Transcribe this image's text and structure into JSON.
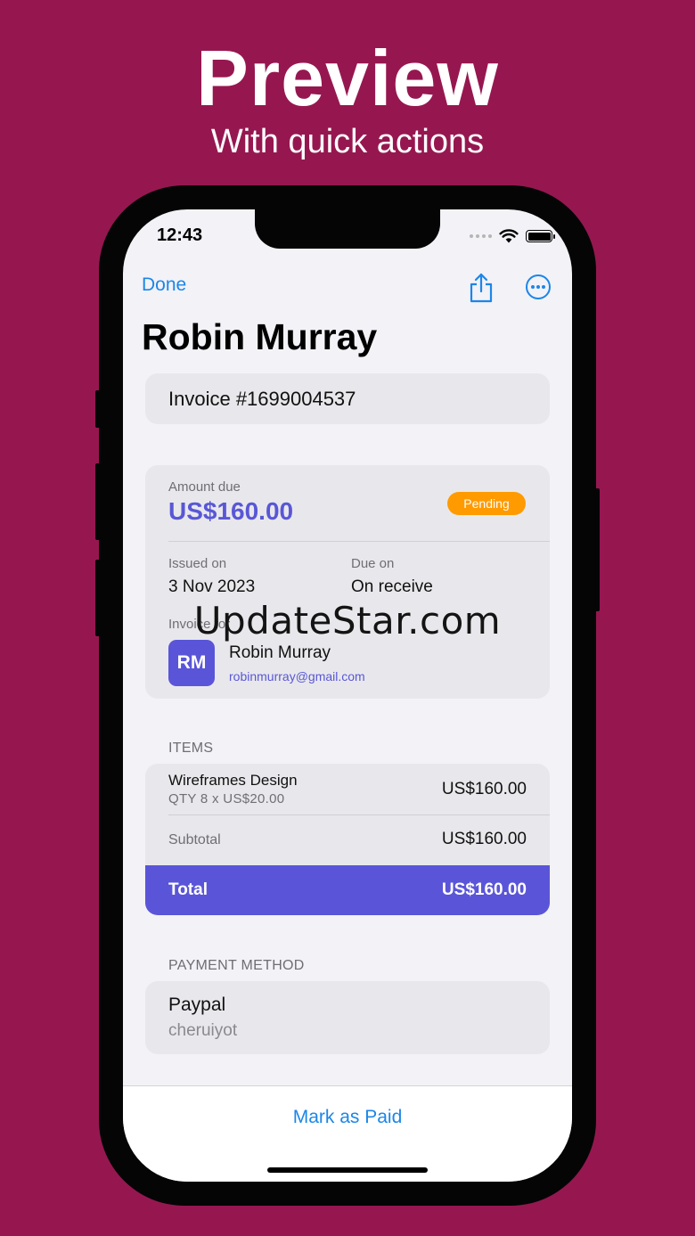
{
  "promo": {
    "title": "Preview",
    "subtitle": "With quick actions"
  },
  "status_bar": {
    "time": "12:43"
  },
  "nav": {
    "done_label": "Done"
  },
  "page_title": "Robin Murray",
  "invoice": {
    "number": "Invoice #1699004537"
  },
  "amount": {
    "label": "Amount due",
    "value": "US$160.00",
    "status": "Pending"
  },
  "dates": {
    "issued_label": "Issued on",
    "issued_value": "3 Nov 2023",
    "due_label": "Due on",
    "due_value": "On receive"
  },
  "client": {
    "section_label": "Invoice for",
    "initials": "RM",
    "name": "Robin Murray",
    "email": "robinmurray@gmail.com"
  },
  "items": {
    "header": "ITEMS",
    "rows": [
      {
        "name": "Wireframes Design",
        "qty": "QTY 8 x US$20.00",
        "price": "US$160.00"
      }
    ],
    "subtotal_label": "Subtotal",
    "subtotal_value": "US$160.00",
    "total_label": "Total",
    "total_value": "US$160.00"
  },
  "payment": {
    "header": "PAYMENT METHOD",
    "method": "Paypal",
    "account": "cheruiyot"
  },
  "actions": {
    "mark_paid": "Mark as Paid"
  },
  "watermark": "UpdateStar.com",
  "colors": {
    "background": "#961750",
    "accent_blue": "#1c86e8",
    "brand_indigo": "#5a55d8",
    "pending_orange": "#ff9a00"
  },
  "icons": {
    "share": "share-icon",
    "more": "ellipsis-circle-icon",
    "wifi": "wifi-icon",
    "battery": "battery-icon"
  }
}
